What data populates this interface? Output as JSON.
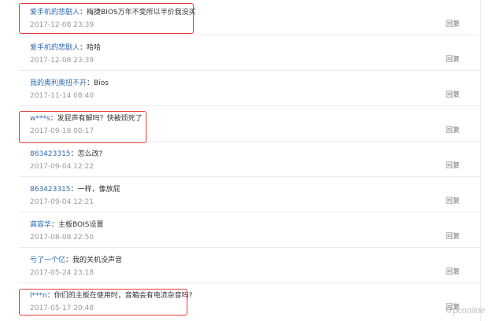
{
  "comments": [
    {
      "user": "爱手机的悲剧人",
      "text": "：梅捷BIOS万年不变所以半价我没买",
      "date": "2017-12-08 23:39",
      "reply": "回复"
    },
    {
      "user": "爱手机的悲剧人",
      "text": "：哈哈",
      "date": "2017-12-08 23:39",
      "reply": "回复"
    },
    {
      "user": "我的奥利奥扭不开",
      "text": "：Bios",
      "date": "2017-11-14 08:40",
      "reply": "回复"
    },
    {
      "user": "w***s",
      "text": "：发屁声有解吗？快被烦死了",
      "date": "2017-09-18 00:17",
      "reply": "回复"
    },
    {
      "user": "863423315",
      "text": "：怎么改?",
      "date": "2017-09-04 12:22",
      "reply": "回复"
    },
    {
      "user": "863423315",
      "text": "：一样，像放屁",
      "date": "2017-09-04 12:21",
      "reply": "回复"
    },
    {
      "user": "龚容华",
      "text": "：主板BOIS设置",
      "date": "2017-08-08 22:50",
      "reply": "回复"
    },
    {
      "user": "亏了一个亿",
      "text": "：我的关机没声音",
      "date": "2017-05-24 23:18",
      "reply": "回复"
    },
    {
      "user": "l***n",
      "text": "：你们的主板在使用时，音箱会有电流杂音吗?",
      "date": "2017-05-17 20:48",
      "reply": "回复"
    }
  ],
  "watermark": "pconline",
  "colors": {
    "user_link": "#2e6ab0",
    "highlight": "#e53935",
    "date": "#9a9a9a"
  }
}
